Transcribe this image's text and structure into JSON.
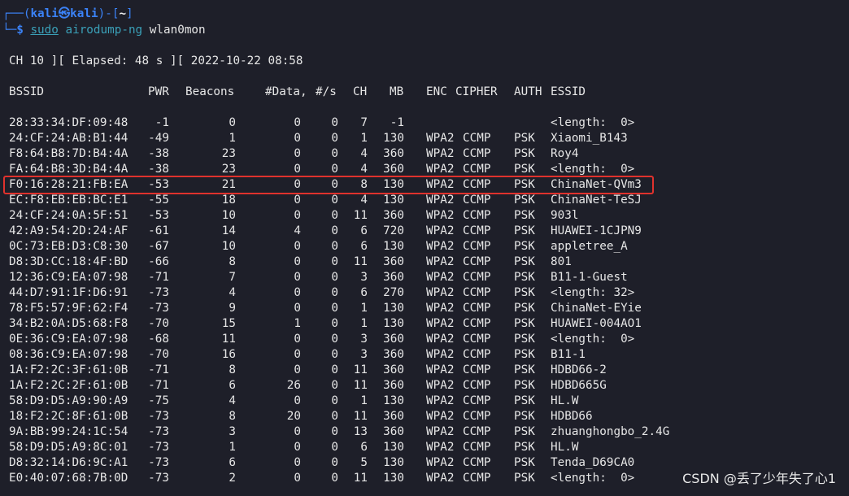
{
  "prompt": {
    "open_bracket": "┌──(",
    "user": "kali",
    "at_symbol": "㉿",
    "host": "kali",
    "close_bracket": ")-[",
    "cwd": "~",
    "end_bracket": "]",
    "corner": "└─",
    "dollar": "$",
    "sudo": "sudo",
    "program": "airodump-ng",
    "argument": "wlan0mon"
  },
  "status_line": "CH 10 ][ Elapsed: 48 s ][ 2022-10-22 08:58",
  "columns": {
    "bssid": "BSSID",
    "pwr": "PWR",
    "beacons": "Beacons",
    "data": "#Data,",
    "per_s": "#/s",
    "ch": "CH",
    "mb": "MB",
    "enc": "ENC",
    "cipher": "CIPHER",
    "auth": "AUTH",
    "essid": "ESSID"
  },
  "rows": [
    {
      "bssid": "28:33:34:DF:09:48",
      "pwr": "-1",
      "beacons": "0",
      "data": "0",
      "per_s": "0",
      "ch": "7",
      "mb": "-1",
      "enc": "",
      "cipher": "",
      "auth": "",
      "essid": "<length:  0>"
    },
    {
      "bssid": "24:CF:24:AB:B1:44",
      "pwr": "-49",
      "beacons": "1",
      "data": "0",
      "per_s": "0",
      "ch": "1",
      "mb": "130",
      "enc": "WPA2",
      "cipher": "CCMP",
      "auth": "PSK",
      "essid": "Xiaomi_B143"
    },
    {
      "bssid": "F8:64:B8:7D:B4:4A",
      "pwr": "-38",
      "beacons": "23",
      "data": "0",
      "per_s": "0",
      "ch": "4",
      "mb": "360",
      "enc": "WPA2",
      "cipher": "CCMP",
      "auth": "PSK",
      "essid": "Roy4"
    },
    {
      "bssid": "FA:64:B8:3D:B4:4A",
      "pwr": "-38",
      "beacons": "23",
      "data": "0",
      "per_s": "0",
      "ch": "4",
      "mb": "360",
      "enc": "WPA2",
      "cipher": "CCMP",
      "auth": "PSK",
      "essid": "<length:  0>"
    },
    {
      "bssid": "F0:16:28:21:FB:EA",
      "pwr": "-53",
      "beacons": "21",
      "data": "0",
      "per_s": "0",
      "ch": "8",
      "mb": "130",
      "enc": "WPA2",
      "cipher": "CCMP",
      "auth": "PSK",
      "essid": "ChinaNet-QVm3"
    },
    {
      "bssid": "EC:F8:EB:EB:BC:E1",
      "pwr": "-55",
      "beacons": "18",
      "data": "0",
      "per_s": "0",
      "ch": "4",
      "mb": "130",
      "enc": "WPA2",
      "cipher": "CCMP",
      "auth": "PSK",
      "essid": "ChinaNet-TeSJ"
    },
    {
      "bssid": "24:CF:24:0A:5F:51",
      "pwr": "-53",
      "beacons": "10",
      "data": "0",
      "per_s": "0",
      "ch": "11",
      "mb": "360",
      "enc": "WPA2",
      "cipher": "CCMP",
      "auth": "PSK",
      "essid": "903l"
    },
    {
      "bssid": "42:A9:54:2D:24:AF",
      "pwr": "-61",
      "beacons": "14",
      "data": "4",
      "per_s": "0",
      "ch": "6",
      "mb": "720",
      "enc": "WPA2",
      "cipher": "CCMP",
      "auth": "PSK",
      "essid": "HUAWEI-1CJPN9"
    },
    {
      "bssid": "0C:73:EB:D3:C8:30",
      "pwr": "-67",
      "beacons": "10",
      "data": "0",
      "per_s": "0",
      "ch": "6",
      "mb": "130",
      "enc": "WPA2",
      "cipher": "CCMP",
      "auth": "PSK",
      "essid": "appletree_A"
    },
    {
      "bssid": "D8:3D:CC:18:4F:BD",
      "pwr": "-66",
      "beacons": "8",
      "data": "0",
      "per_s": "0",
      "ch": "11",
      "mb": "360",
      "enc": "WPA2",
      "cipher": "CCMP",
      "auth": "PSK",
      "essid": "801"
    },
    {
      "bssid": "12:36:C9:EA:07:98",
      "pwr": "-71",
      "beacons": "7",
      "data": "0",
      "per_s": "0",
      "ch": "3",
      "mb": "360",
      "enc": "WPA2",
      "cipher": "CCMP",
      "auth": "PSK",
      "essid": "B11-1-Guest"
    },
    {
      "bssid": "44:D7:91:1F:D6:91",
      "pwr": "-73",
      "beacons": "4",
      "data": "0",
      "per_s": "0",
      "ch": "6",
      "mb": "270",
      "enc": "WPA2",
      "cipher": "CCMP",
      "auth": "PSK",
      "essid": "<length: 32>"
    },
    {
      "bssid": "78:F5:57:9F:62:F4",
      "pwr": "-73",
      "beacons": "9",
      "data": "0",
      "per_s": "0",
      "ch": "1",
      "mb": "130",
      "enc": "WPA2",
      "cipher": "CCMP",
      "auth": "PSK",
      "essid": "ChinaNet-EYie"
    },
    {
      "bssid": "34:B2:0A:D5:68:F8",
      "pwr": "-70",
      "beacons": "15",
      "data": "1",
      "per_s": "0",
      "ch": "1",
      "mb": "130",
      "enc": "WPA2",
      "cipher": "CCMP",
      "auth": "PSK",
      "essid": "HUAWEI-004AO1"
    },
    {
      "bssid": "0E:36:C9:EA:07:98",
      "pwr": "-68",
      "beacons": "11",
      "data": "0",
      "per_s": "0",
      "ch": "3",
      "mb": "360",
      "enc": "WPA2",
      "cipher": "CCMP",
      "auth": "PSK",
      "essid": "<length:  0>"
    },
    {
      "bssid": "08:36:C9:EA:07:98",
      "pwr": "-70",
      "beacons": "16",
      "data": "0",
      "per_s": "0",
      "ch": "3",
      "mb": "360",
      "enc": "WPA2",
      "cipher": "CCMP",
      "auth": "PSK",
      "essid": "B11-1"
    },
    {
      "bssid": "1A:F2:2C:3F:61:0B",
      "pwr": "-71",
      "beacons": "8",
      "data": "0",
      "per_s": "0",
      "ch": "11",
      "mb": "360",
      "enc": "WPA2",
      "cipher": "CCMP",
      "auth": "PSK",
      "essid": "HDBD66-2"
    },
    {
      "bssid": "1A:F2:2C:2F:61:0B",
      "pwr": "-71",
      "beacons": "6",
      "data": "26",
      "per_s": "0",
      "ch": "11",
      "mb": "360",
      "enc": "WPA2",
      "cipher": "CCMP",
      "auth": "PSK",
      "essid": "HDBD665G"
    },
    {
      "bssid": "58:D9:D5:A9:90:A9",
      "pwr": "-75",
      "beacons": "4",
      "data": "0",
      "per_s": "0",
      "ch": "1",
      "mb": "130",
      "enc": "WPA2",
      "cipher": "CCMP",
      "auth": "PSK",
      "essid": "HL.W"
    },
    {
      "bssid": "18:F2:2C:8F:61:0B",
      "pwr": "-73",
      "beacons": "8",
      "data": "20",
      "per_s": "0",
      "ch": "11",
      "mb": "360",
      "enc": "WPA2",
      "cipher": "CCMP",
      "auth": "PSK",
      "essid": "HDBD66"
    },
    {
      "bssid": "9A:BB:99:24:1C:54",
      "pwr": "-73",
      "beacons": "3",
      "data": "0",
      "per_s": "0",
      "ch": "13",
      "mb": "360",
      "enc": "WPA2",
      "cipher": "CCMP",
      "auth": "PSK",
      "essid": "zhuanghongbo_2.4G"
    },
    {
      "bssid": "58:D9:D5:A9:8C:01",
      "pwr": "-73",
      "beacons": "1",
      "data": "0",
      "per_s": "0",
      "ch": "6",
      "mb": "130",
      "enc": "WPA2",
      "cipher": "CCMP",
      "auth": "PSK",
      "essid": "HL.W"
    },
    {
      "bssid": "D8:32:14:D6:9C:A1",
      "pwr": "-73",
      "beacons": "6",
      "data": "0",
      "per_s": "0",
      "ch": "5",
      "mb": "130",
      "enc": "WPA2",
      "cipher": "CCMP",
      "auth": "PSK",
      "essid": "Tenda_D69CA0"
    },
    {
      "bssid": "E0:40:07:68:7B:0D",
      "pwr": "-73",
      "beacons": "2",
      "data": "0",
      "per_s": "0",
      "ch": "11",
      "mb": "130",
      "enc": "WPA2",
      "cipher": "CCMP",
      "auth": "PSK",
      "essid": "<length:  0>"
    }
  ],
  "highlighted_bssid": "F0:16:28:21:FB:EA",
  "watermark": "CSDN @丢了少年失了心1",
  "colors": {
    "background": "#1e1f29",
    "prompt_blue": "#3b82f6",
    "command_cyan": "#3aa0b8",
    "highlight_red": "#e0322d"
  }
}
